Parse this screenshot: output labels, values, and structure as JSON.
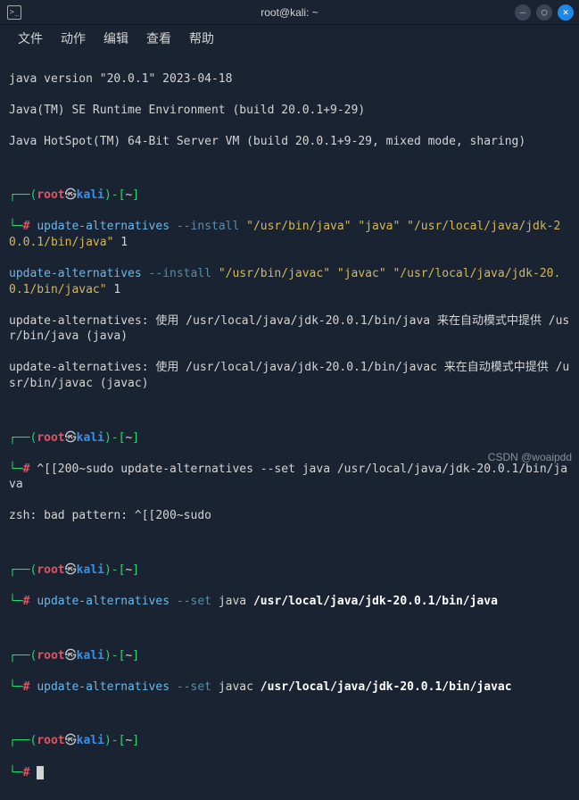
{
  "window": {
    "icon_glyph": ">_",
    "title": "root@kali: ~",
    "min_glyph": "–",
    "max_glyph": "○",
    "close_glyph": "✕"
  },
  "menubar": {
    "file": "文件",
    "action": "动作",
    "edit": "编辑",
    "view": "查看",
    "help": "帮助"
  },
  "prompt": {
    "open_conn": "┌──(",
    "user": "root",
    "at": "㉿",
    "host": "kali",
    "close_paren": ")",
    "dash_open": "-[",
    "cwd": "~",
    "close_bracket": "]",
    "line2": "└─",
    "hash": "#"
  },
  "output": {
    "java_version": "java version \"20.0.1\" 2023-04-18",
    "java_runtime": "Java(TM) SE Runtime Environment (build 20.0.1+9-29)",
    "java_hotspot": "Java HotSpot(TM) 64-Bit Server VM (build 20.0.1+9-29, mixed mode, sharing)"
  },
  "cmd1": {
    "name": "update-alternatives",
    "opt": " --install ",
    "args": "\"/usr/bin/java\" \"java\" \"/usr/local/java/jdk-20.0.1/bin/java\"",
    "num": " 1"
  },
  "cmd2": {
    "name": "update-alternatives",
    "opt": " --install ",
    "args": "\"/usr/bin/javac\" \"javac\" \"/usr/local/java/jdk-20.0.1/bin/javac\"",
    "num": " 1"
  },
  "out_alt": {
    "line1": "update-alternatives: 使用 /usr/local/java/jdk-20.0.1/bin/java 来在自动模式中提供 /usr/bin/java (java)",
    "line2": "update-alternatives: 使用 /usr/local/java/jdk-20.0.1/bin/javac 来在自动模式中提供 /usr/bin/javac (javac)"
  },
  "cmd3": {
    "raw": "^[[200~sudo update-alternatives --set java /usr/local/java/jdk-20.0.1/bin/java"
  },
  "out_zsh": "zsh: bad pattern: ^[[200~sudo",
  "cmd4": {
    "name": "update-alternatives",
    "opt": " --set ",
    "arg1": "java ",
    "path": "/usr/local/java/jdk-20.0.1/bin/java"
  },
  "cmd5": {
    "name": "update-alternatives",
    "opt": " --set ",
    "arg1": "javac ",
    "path": "/usr/local/java/jdk-20.0.1/bin/javac"
  },
  "watermark": "CSDN @woaipdd"
}
